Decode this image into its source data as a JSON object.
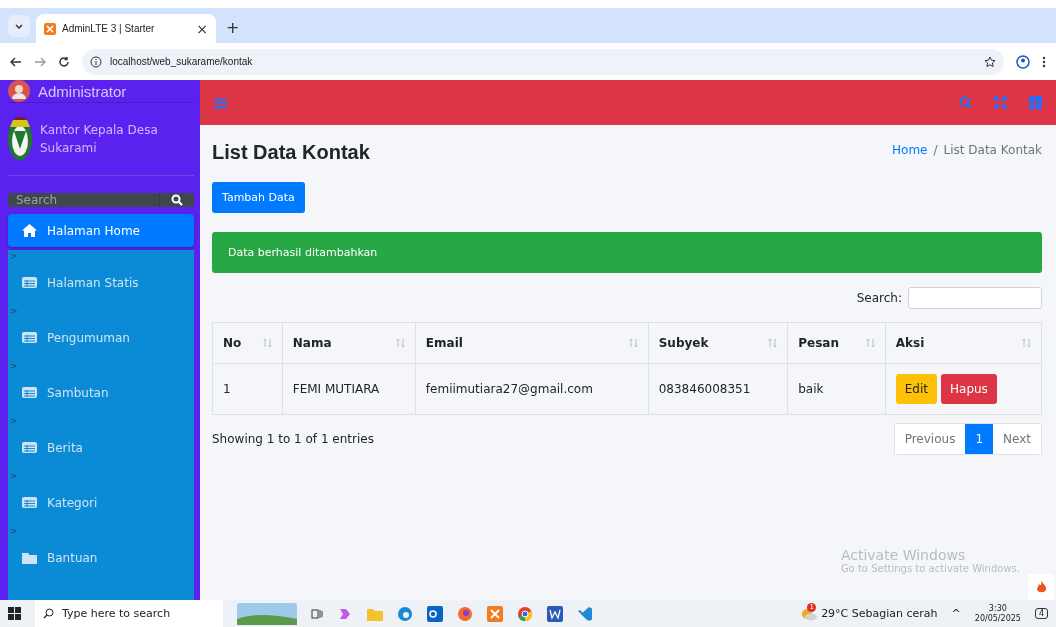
{
  "browser": {
    "tab_title": "AdminLTE 3 | Starter",
    "new_tab": "+",
    "close": "×",
    "url": "localhost/web_sukarame/kontak"
  },
  "sidebar": {
    "user": "Administrator",
    "brand": "Kantor Kepala Desa Sukarami",
    "search": {
      "placeholder": "Search"
    },
    "items": [
      {
        "label": "Halaman Home",
        "kind": "home",
        "selected": true
      },
      {
        "label": "Halaman Statis",
        "kind": "table",
        "selected": false
      },
      {
        "label": "Pengumuman",
        "kind": "table",
        "selected": false
      },
      {
        "label": "Sambutan",
        "kind": "table",
        "selected": false
      },
      {
        "label": "Berita",
        "kind": "table",
        "selected": false
      },
      {
        "label": "Kategori",
        "kind": "table",
        "selected": false
      },
      {
        "label": "Bantuan",
        "kind": "folder",
        "selected": false
      }
    ],
    "arrow": ">"
  },
  "content": {
    "title": "List Data Kontak",
    "breadcrumb": [
      {
        "label": "Home",
        "link": true
      },
      {
        "label": "List Data Kontak",
        "link": false
      }
    ],
    "breadcrumb_sep": "/",
    "add_button": "Tambah Data",
    "alert": "Data berhasil ditambahkan",
    "search_label": "Search:",
    "table": {
      "columns": [
        "No",
        "Nama",
        "Email",
        "Subyek",
        "Pesan",
        "Aksi"
      ],
      "rows": [
        {
          "cells": [
            "1",
            "FEMI MUTIARA",
            "femiimutiara27@gmail.com",
            "083846008351",
            "baik"
          ],
          "actions": [
            {
              "label": "Edit",
              "kind": "warning"
            },
            {
              "label": "Hapus",
              "kind": "danger"
            }
          ]
        }
      ]
    },
    "info": "Showing 1 to 1 of 1 entries",
    "pagination": [
      {
        "label": "Previous",
        "selected": false
      },
      {
        "label": "1",
        "selected": true
      },
      {
        "label": "Next",
        "selected": false
      }
    ]
  },
  "activation": {
    "title": "Activate Windows",
    "subtitle": "Go to Settings to activate Windows."
  },
  "taskbar": {
    "search": {
      "placeholder": "Type here to search"
    },
    "weather": "29°C  Sebagian cerah",
    "weather_badge": "1",
    "caret": "^",
    "time": "3:30",
    "date": "20/05/2025",
    "notifications": "4"
  }
}
